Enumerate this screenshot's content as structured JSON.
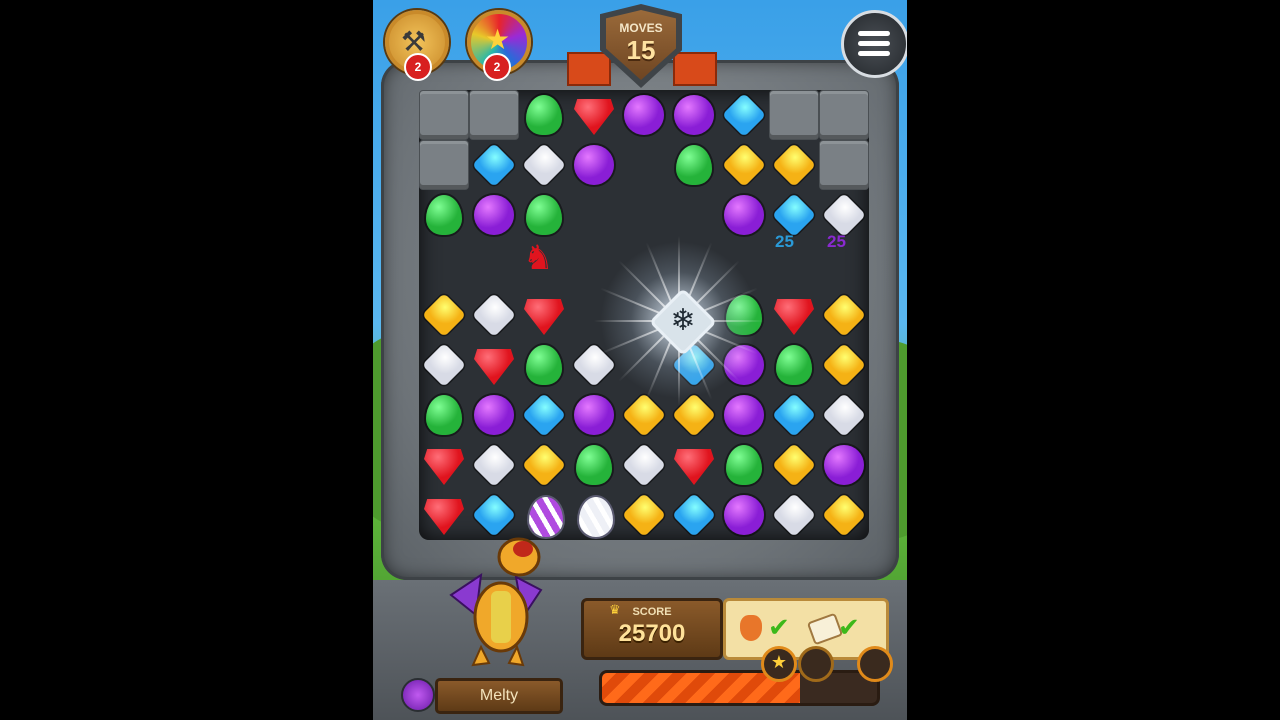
{
  "hud": {
    "moves_label": "MOVES",
    "moves_value": "15",
    "boosters": [
      {
        "icon": "hammer-icon",
        "count": "2"
      },
      {
        "icon": "star-ball-icon",
        "count": "2"
      }
    ],
    "menu_icon": "menu-icon"
  },
  "board": {
    "points_popups": [
      {
        "text": "25",
        "color": "#2a9ad8"
      },
      {
        "text": "25",
        "color": "#8a2ad0"
      }
    ],
    "rows": [
      [
        "block",
        "block",
        "green",
        "red",
        "purple",
        "purple",
        "blue",
        "block",
        "block"
      ],
      [
        "block",
        "blue",
        "white",
        "purple",
        "",
        "green",
        "yellow",
        "yellow",
        "block"
      ],
      [
        "green",
        "purple",
        "green",
        "",
        "",
        "",
        "purple",
        "blue",
        "white"
      ],
      [
        "",
        "",
        "",
        "",
        "",
        "",
        "",
        "",
        ""
      ],
      [
        "yellow",
        "white",
        "red",
        "",
        "",
        "",
        "green",
        "red",
        "yellow"
      ],
      [
        "white",
        "red",
        "green",
        "white",
        "",
        "blue",
        "purple",
        "green",
        "yellow"
      ],
      [
        "green",
        "purple",
        "blue",
        "purple",
        "yellow",
        "yellow",
        "purple",
        "blue",
        "white"
      ],
      [
        "red",
        "white",
        "yellow",
        "green",
        "white",
        "red",
        "green",
        "yellow",
        "purple"
      ],
      [
        "red",
        "blue",
        "egg-purple",
        "egg-white",
        "yellow",
        "blue",
        "purple",
        "white",
        "yellow"
      ]
    ]
  },
  "footer": {
    "score_label": "SCORE",
    "score_value": "25700",
    "character_name": "Melty",
    "goals": [
      {
        "icon": "potion-icon",
        "done": true
      },
      {
        "icon": "scroll-icon",
        "done": true
      }
    ],
    "progress": 0.72,
    "stars": [
      "★",
      "",
      ""
    ]
  },
  "colors": {
    "green": "#25b33a",
    "red": "#e0141e",
    "purple": "#8a1ed6",
    "blue": "#2aa4f0",
    "yellow": "#f5b215",
    "white": "#d8dbe6"
  }
}
